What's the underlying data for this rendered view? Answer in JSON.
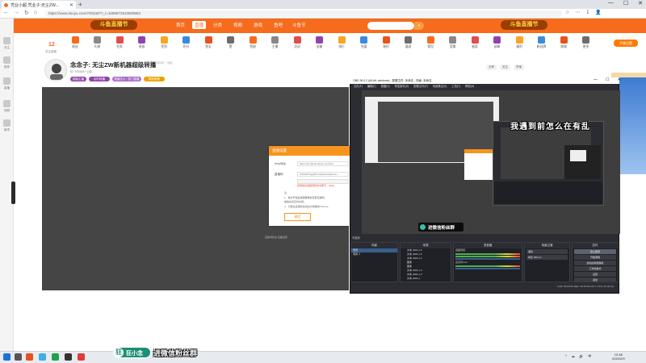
{
  "browser": {
    "tab_title": "凭业小超·凭业子:无尘ZW...",
    "new_tab": "+",
    "window_controls": [
      "—",
      "☐",
      "✕"
    ],
    "url": "https://www.douyu.com/7003497?_t=1698673910609883",
    "nav": [
      "←",
      "→",
      "↻",
      "⌂"
    ],
    "icons": [
      "☆",
      "⋯",
      "↧",
      "👤"
    ]
  },
  "sidebar": {
    "labels": [
      "关注",
      "推荐",
      "直播",
      "视频",
      "鱼吧"
    ]
  },
  "douyu": {
    "logo": "斗鱼直播节",
    "nav": [
      "首页",
      "直播",
      "分类",
      "视频",
      "游戏",
      "鱼吧",
      "斗鱼节"
    ],
    "nav_selected": 1,
    "search_placeholder": "",
    "right_logo": "斗鱼直播节",
    "count": "12",
    "count_label": "关注频道",
    "toolbar": [
      "粉丝",
      "礼物",
      "任务",
      "贵族",
      "签到",
      "积分",
      "鱼丸",
      "赞",
      "鱼翅",
      "主播",
      "活动",
      "宝箱",
      "排行",
      "充值",
      "装扮",
      "道具",
      "背包",
      "竞猜",
      "抽奖",
      "勋章",
      "福利",
      "粉丝牌",
      "商城",
      "更多"
    ],
    "streamer_btn": "开播设置"
  },
  "room": {
    "title": "念念子: 无尘ZW新机器超级转播",
    "meta": "直播间 · 房间号 7003497 · 分区",
    "meta2": "ID: 7003497  公告",
    "tags": [
      "超级主播",
      "实时转播",
      "频道达人 · 热门直播",
      "精彩推荐"
    ],
    "right_buttons": [
      "分享",
      "关注",
      "举报"
    ]
  },
  "dialog": {
    "title": "直播设置",
    "row1_label": "rtmp地址:",
    "row1_value": "https://sendtc3a.douyu.com/live",
    "row2_label": "直播码:",
    "row2_value": "7003497rtqgZ2CYwbw?wsSecret=...",
    "red_note": "复制地址到推流软件中即可，2020...",
    "notes": [
      "注：",
      "1、每次开始直播需要重新获取直播码，",
      "   播放后请及时关闭。",
      "2、只能在直播码生效后才能推送Chrome..."
    ],
    "button": "确定",
    "below": "直播间状态    直播设置"
  },
  "obs": {
    "title": "OBS 26.0.2 (64-bit, windows) - 配置文件: 未命名 - 场景: 未命名",
    "window_controls": [
      "—",
      "☐",
      "✕"
    ],
    "menu": [
      "文件(F)",
      "编辑(E)",
      "视图(V)",
      "停靠部件(D)",
      "配置文件(P)",
      "场景集合(S)",
      "工具(T)",
      "帮助(H)"
    ],
    "overlay_text": "我遇到前怎么在有乱",
    "badge_text": "进微信粉丝群",
    "scene_bar": "不适用",
    "docks": {
      "scenes": {
        "title": "场景",
        "items": [
          "场景",
          "场景 2"
        ]
      },
      "sources": {
        "title": "来源",
        "items": [
          "文本 (GDI+) 6",
          "文本 (GDI+) 5",
          "文本 (GDI+) 4",
          "图像",
          "图像",
          "文本 (GDI+) 3",
          "文本 (GDI+) 2",
          "文本 (GDI+)"
        ]
      },
      "mixer": {
        "title": "混音器",
        "channels": [
          "桌面音频",
          "麦克风/Aux"
        ]
      },
      "transitions": {
        "title": "场景过渡",
        "items": [
          "渐隐",
          "时长 300 ms"
        ]
      },
      "controls": {
        "title": "控件",
        "items": [
          "停止推流",
          "开始录制",
          "启动虚拟摄像机",
          "工作室模式",
          "设置",
          "退出"
        ]
      }
    },
    "status": "LIVE: 00:00:00   REC: 00:00:00   CPU: 3.5%, 30.00 fps"
  },
  "banner": {
    "icon": "狂",
    "name": "狂小念",
    "slogan": "进微信粉丝群"
  },
  "taskbar": {
    "tray": "^ ☁ 🔊 中",
    "clock_time": "12:46",
    "clock_date": "2022/2/9"
  }
}
